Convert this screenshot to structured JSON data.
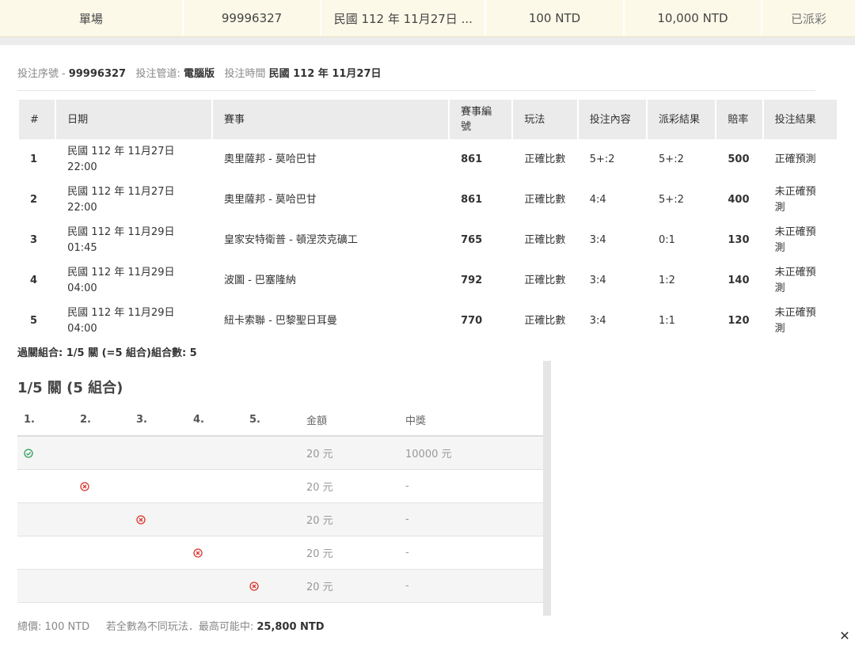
{
  "summary": {
    "type": "單場",
    "ticket_no": "99996327",
    "date": "民國 112 年 11月27日 ...",
    "stake": "100 NTD",
    "payout": "10,000 NTD",
    "status": "已派彩"
  },
  "meta": {
    "serial_label": "投注序號",
    "serial_value": "99996327",
    "channel_label": "投注管道:",
    "channel_value": "電腦版",
    "time_label": "投注時間",
    "time_value": "民國 112 年 11月27日"
  },
  "legs": {
    "headers": {
      "idx": "#",
      "date": "日期",
      "match": "賽事",
      "code": "賽事編號",
      "play": "玩法",
      "pick": "投注內容",
      "result": "派彩結果",
      "odds": "賠率",
      "outcome": "投注結果"
    },
    "rows": [
      {
        "idx": "1",
        "date": "民國 112 年 11月27日",
        "time": "22:00",
        "match": "奧里薩邦 - 莫哈巴甘",
        "code": "861",
        "play": "正確比數",
        "pick": "5+:2",
        "result": "5+:2",
        "odds": "500",
        "outcome": "正確預測"
      },
      {
        "idx": "2",
        "date": "民國 112 年 11月27日",
        "time": "22:00",
        "match": "奧里薩邦 - 莫哈巴甘",
        "code": "861",
        "play": "正確比數",
        "pick": "4:4",
        "result": "5+:2",
        "odds": "400",
        "outcome": "未正確預測"
      },
      {
        "idx": "3",
        "date": "民國 112 年 11月29日",
        "time": "01:45",
        "match": "皇家安特衛普 - 頓涅茨克礦工",
        "code": "765",
        "play": "正確比數",
        "pick": "3:4",
        "result": "0:1",
        "odds": "130",
        "outcome": "未正確預測"
      },
      {
        "idx": "4",
        "date": "民國 112 年 11月29日",
        "time": "04:00",
        "match": "波圖 - 巴塞隆納",
        "code": "792",
        "play": "正確比數",
        "pick": "3:4",
        "result": "1:2",
        "odds": "140",
        "outcome": "未正確預測"
      },
      {
        "idx": "5",
        "date": "民國 112 年 11月29日",
        "time": "04:00",
        "match": "紐卡索聯 - 巴黎聖日耳曼",
        "code": "770",
        "play": "正確比數",
        "pick": "3:4",
        "result": "1:1",
        "odds": "120",
        "outcome": "未正確預測"
      }
    ]
  },
  "combo_note": "過關組合: 1/5 關 (=5 組合)組合數: 5",
  "combos": {
    "title": "1/5 關 (5 組合)",
    "headers": {
      "c1": "1.",
      "c2": "2.",
      "c3": "3.",
      "c4": "4.",
      "c5": "5.",
      "amount": "金額",
      "prize": "中獎"
    },
    "rows": [
      {
        "col": 1,
        "icon": "check-circle-icon",
        "amount": "20 元",
        "prize": "10000 元"
      },
      {
        "col": 2,
        "icon": "cross-circle-icon",
        "amount": "20 元",
        "prize": "-"
      },
      {
        "col": 3,
        "icon": "cross-circle-icon",
        "amount": "20 元",
        "prize": "-"
      },
      {
        "col": 4,
        "icon": "cross-circle-icon",
        "amount": "20 元",
        "prize": "-"
      },
      {
        "col": 5,
        "icon": "cross-circle-icon",
        "amount": "20 元",
        "prize": "-"
      }
    ]
  },
  "footer": {
    "total_label": "總價:",
    "total_value": "100 NTD",
    "max_label": "若全數為不同玩法．最高可能中:",
    "max_value": "25,800 NTD"
  },
  "close_label": "✕",
  "colors": {
    "win": "#2e9e5b",
    "loss": "#d9342b",
    "band": "#fcf9e8"
  }
}
